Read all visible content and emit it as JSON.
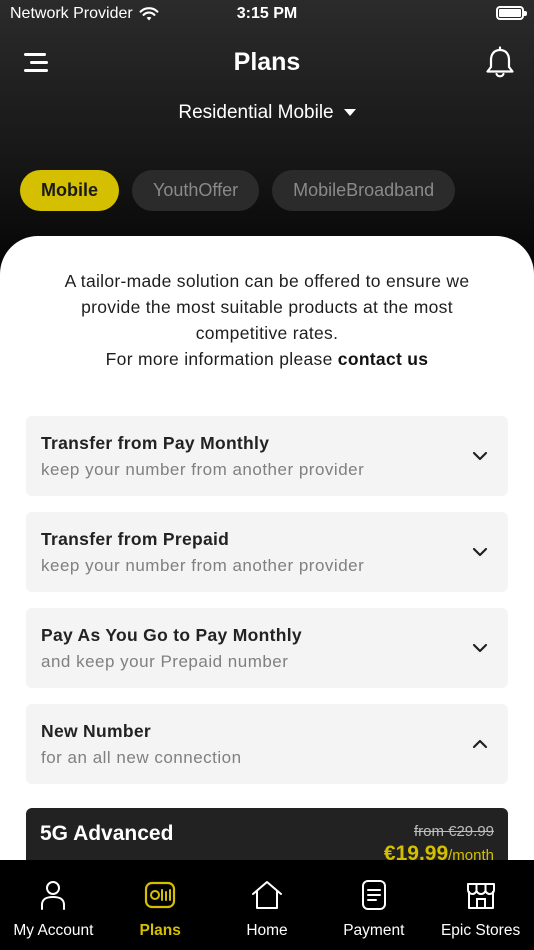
{
  "status_bar": {
    "carrier": "Network Provider",
    "time": "3:15 PM"
  },
  "header": {
    "title": "Plans",
    "segment_selector": "Residential Mobile"
  },
  "chips": [
    {
      "label": "Mobile",
      "active": true
    },
    {
      "label": "YouthOffer",
      "active": false
    },
    {
      "label": "MobileBroadband",
      "active": false
    }
  ],
  "intro": {
    "text": "A tailor-made solution can be offered to ensure we provide the most suitable products at the most competitive rates.",
    "more_info_prefix": "For more information please",
    "contact_link": "contact us"
  },
  "accordions": [
    {
      "title": "Transfer from Pay Monthly",
      "subtitle": "keep your number from another provider",
      "expanded": false
    },
    {
      "title": "Transfer from Prepaid",
      "subtitle": "keep your number from another provider",
      "expanded": false
    },
    {
      "title": "Pay As You Go to Pay Monthly",
      "subtitle": "and keep your Prepaid number",
      "expanded": false
    },
    {
      "title": "New Number",
      "subtitle": "for an all new connection",
      "expanded": true
    }
  ],
  "plan_card": {
    "name": "5G Advanced",
    "original_price": "from €29.99",
    "price": "€19.99",
    "period": "/month"
  },
  "tabbar": [
    {
      "label": "My Account",
      "icon": "person-icon",
      "active": false
    },
    {
      "label": "Plans",
      "icon": "plans-icon",
      "active": true
    },
    {
      "label": "Home",
      "icon": "home-icon",
      "active": false
    },
    {
      "label": "Payment",
      "icon": "receipt-icon",
      "active": false
    },
    {
      "label": "Epic Stores",
      "icon": "store-icon",
      "active": false
    }
  ],
  "colors": {
    "accent": "#d4bf00",
    "background_dark": "#000000",
    "card": "#ffffff",
    "accordion_bg": "#f4f4f4"
  }
}
